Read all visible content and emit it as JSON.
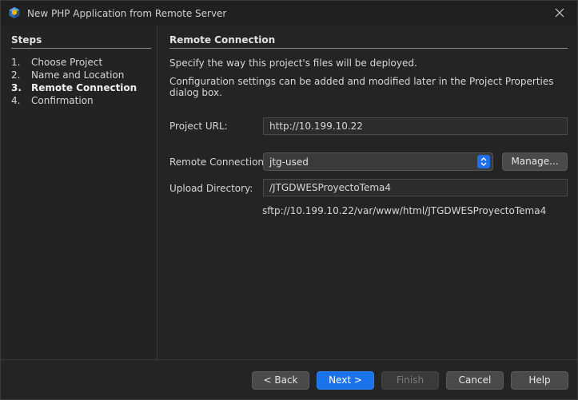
{
  "window": {
    "title": "New PHP Application from Remote Server"
  },
  "steps": {
    "heading": "Steps",
    "items": [
      {
        "num": "1.",
        "label": "Choose Project",
        "active": false
      },
      {
        "num": "2.",
        "label": "Name and Location",
        "active": false
      },
      {
        "num": "3.",
        "label": "Remote Connection",
        "active": true
      },
      {
        "num": "4.",
        "label": "Confirmation",
        "active": false
      }
    ]
  },
  "content": {
    "heading": "Remote Connection",
    "description_1": "Specify the way this project's files will be deployed.",
    "description_2": "Configuration settings can be added and modified later in the Project Properties dialog box.",
    "project_url": {
      "label": "Project URL:",
      "value": "http://10.199.10.22"
    },
    "remote_connection": {
      "label": "Remote Connection:",
      "selected": "jtg-used",
      "manage_label": "Manage..."
    },
    "upload_directory": {
      "label": "Upload Directory:",
      "value": "/JTGDWESProyectoTema4",
      "resolved_path": "sftp://10.199.10.22/var/www/html/JTGDWESProyectoTema4"
    }
  },
  "footer": {
    "back_label": "< Back",
    "next_label": "Next >",
    "finish_label": "Finish",
    "cancel_label": "Cancel",
    "help_label": "Help"
  },
  "colors": {
    "accent": "#1a73e8",
    "background": "#242424",
    "titlebar": "#202020"
  },
  "icons": {
    "app": "netbeans-cube-icon",
    "close": "close-icon",
    "combo_arrow": "updown-chevron-icon"
  }
}
